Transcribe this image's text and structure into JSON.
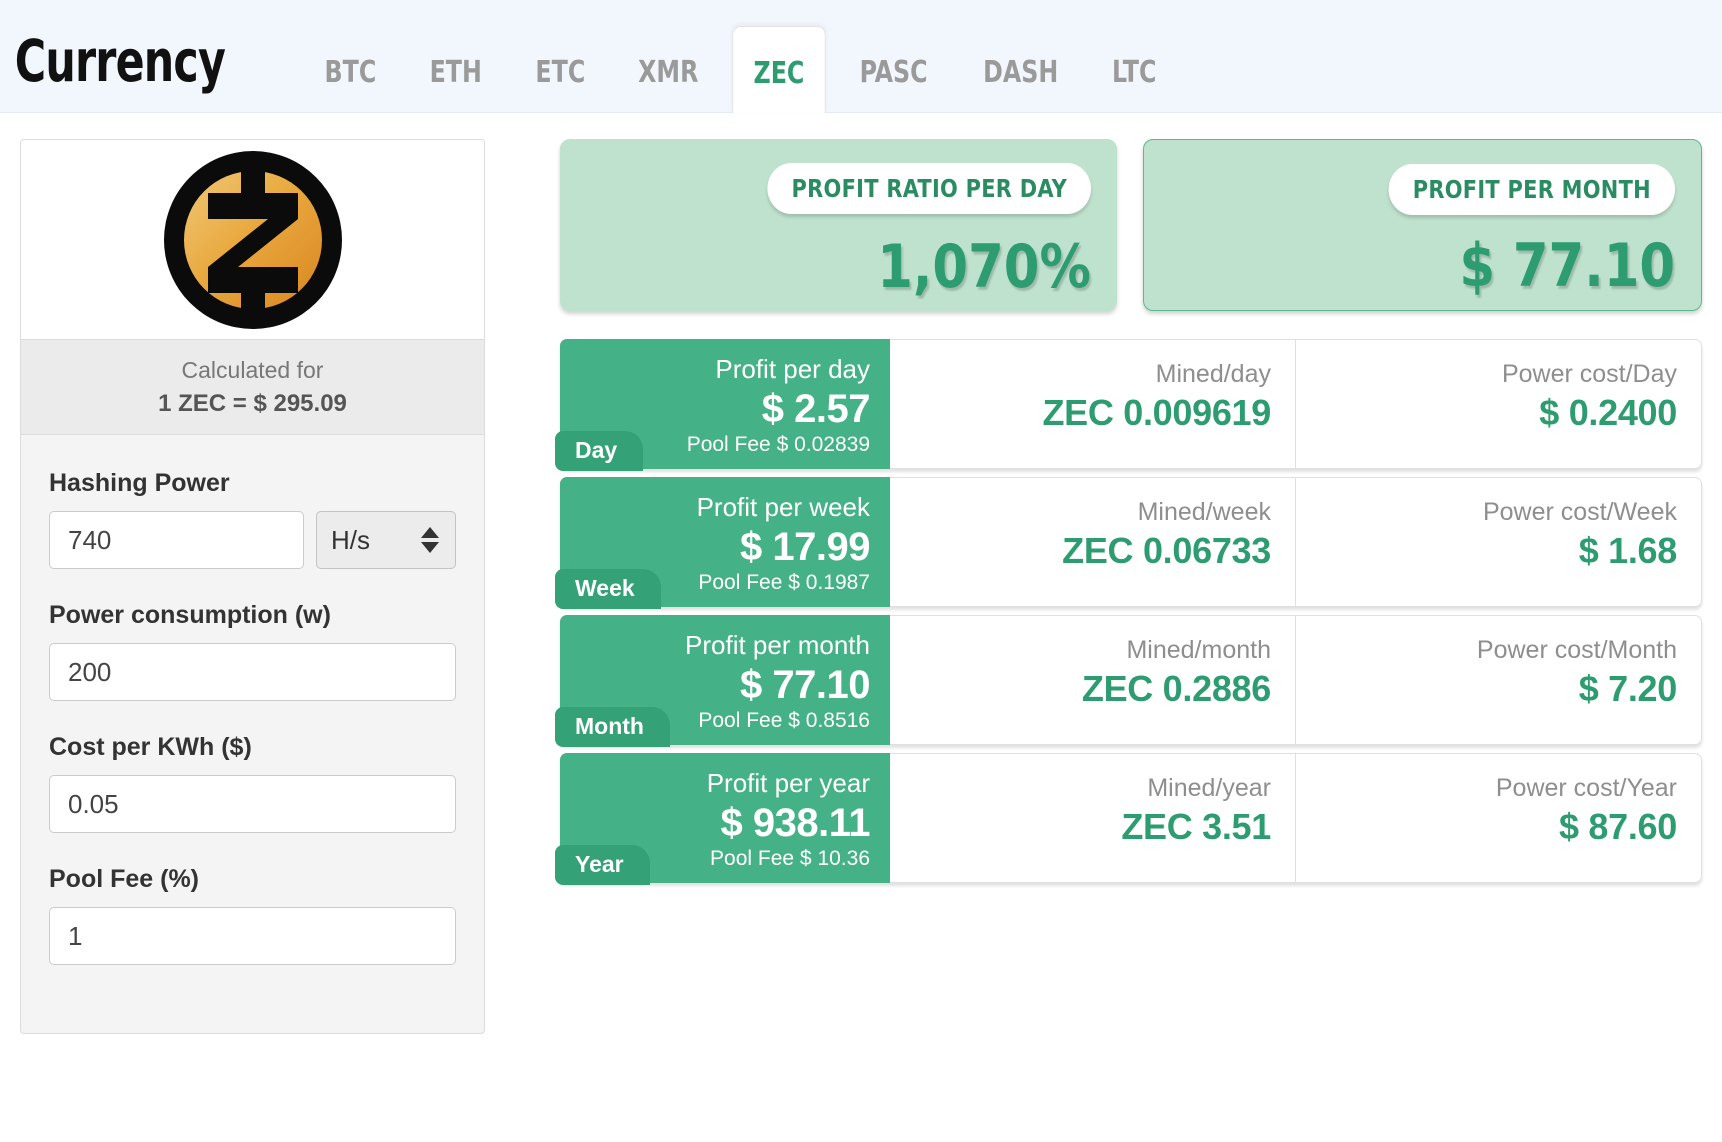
{
  "header": {
    "brand": "Currency",
    "tabs": [
      {
        "label": "BTC",
        "active": false
      },
      {
        "label": "ETH",
        "active": false
      },
      {
        "label": "ETC",
        "active": false
      },
      {
        "label": "XMR",
        "active": false
      },
      {
        "label": "ZEC",
        "active": true
      },
      {
        "label": "PASC",
        "active": false
      },
      {
        "label": "DASH",
        "active": false
      },
      {
        "label": "LTC",
        "active": false
      }
    ],
    "active_tab": "ZEC"
  },
  "sidebar": {
    "coin_icon": "zcash-coin-icon",
    "calculated_for_label": "Calculated for",
    "rate_line": "1 ZEC = $ 295.09",
    "fields": [
      {
        "label": "Hashing Power",
        "value": "740",
        "placeholder": "Hashing power",
        "unit": "H/s",
        "has_unit": true
      },
      {
        "label": "Power consumption (w)",
        "value": "200",
        "placeholder": "Power consumption",
        "has_unit": false
      },
      {
        "label": "Cost per KWh ($)",
        "value": "0.05",
        "placeholder": "Cost per KWh",
        "has_unit": false
      },
      {
        "label": "Pool Fee (%)",
        "value": "1",
        "placeholder": "Pool fee",
        "has_unit": false
      }
    ]
  },
  "summary": {
    "cards": [
      {
        "badge": "PROFIT RATIO PER DAY",
        "value": "1,070%",
        "bordered": false
      },
      {
        "badge": "PROFIT PER MONTH",
        "value": "$ 77.10",
        "bordered": true
      }
    ]
  },
  "results": {
    "rows": [
      {
        "period": "Day",
        "profit_label": "Profit per day",
        "profit_value": "$ 2.57",
        "pool_fee": "Pool Fee $ 0.02839",
        "mined_label": "Mined/day",
        "mined_value": "ZEC 0.009619",
        "power_label": "Power cost/Day",
        "power_value": "$ 0.2400"
      },
      {
        "period": "Week",
        "profit_label": "Profit per week",
        "profit_value": "$ 17.99",
        "pool_fee": "Pool Fee $ 0.1987",
        "mined_label": "Mined/week",
        "mined_value": "ZEC 0.06733",
        "power_label": "Power cost/Week",
        "power_value": "$ 1.68"
      },
      {
        "period": "Month",
        "profit_label": "Profit per month",
        "profit_value": "$ 77.10",
        "pool_fee": "Pool Fee $ 0.8516",
        "mined_label": "Mined/month",
        "mined_value": "ZEC 0.2886",
        "power_label": "Power cost/Month",
        "power_value": "$ 7.20"
      },
      {
        "period": "Year",
        "profit_label": "Profit per year",
        "profit_value": "$ 938.11",
        "pool_fee": "Pool Fee $ 10.36",
        "mined_label": "Mined/year",
        "mined_value": "ZEC 3.51",
        "power_label": "Power cost/Year",
        "power_value": "$ 87.60"
      }
    ]
  },
  "colors": {
    "accent_green": "#45b187",
    "value_green": "#2e9c71",
    "card_green": "#bfe2ce",
    "tab_green": "#34a177",
    "header_bg": "#f2f7fd",
    "coin_gold": "#e8a33d"
  }
}
